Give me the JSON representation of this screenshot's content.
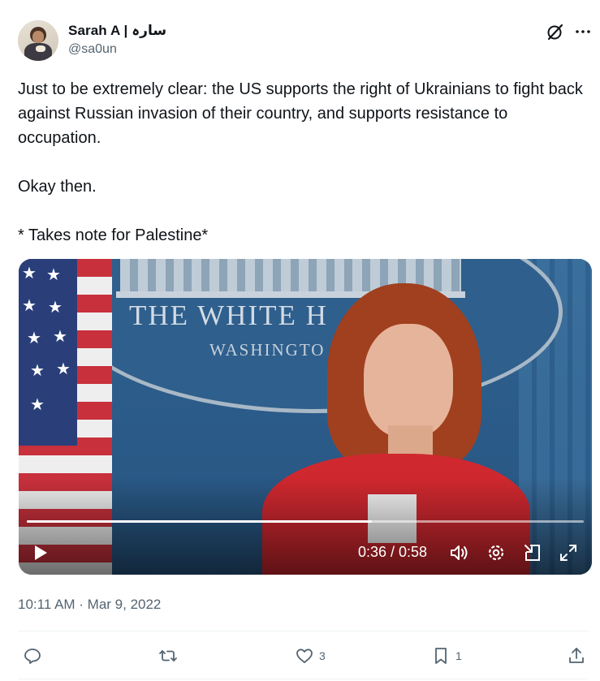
{
  "author": {
    "display_name": "Sarah A | سارہ",
    "handle": "@sa0un"
  },
  "tweet": {
    "text": "Just to be extremely clear: the US supports the right of Ukrainians to fight back against Russian invasion of their country, and supports resistance to occupation.\n\nOkay then.\n\n* Takes note for Palestine*",
    "timestamp": "10:11 AM · Mar 9, 2022"
  },
  "video": {
    "sign_title": "THE WHITE H",
    "sign_subtitle": "WASHINGTO",
    "current_time": "0:36",
    "duration": "0:58",
    "time_display": "0:36 / 0:58",
    "progress": 0.62
  },
  "actions": {
    "reply_count": "",
    "retweet_count": "",
    "like_count": "3",
    "bookmark_count": "1"
  },
  "icons": {
    "header": [
      "grok-icon",
      "more-icon"
    ],
    "video_controls": [
      "play-icon",
      "volume-icon",
      "settings-icon",
      "picture-in-picture-icon",
      "fullscreen-icon"
    ],
    "actions": [
      "reply-icon",
      "retweet-icon",
      "like-icon",
      "bookmark-icon",
      "share-icon"
    ]
  },
  "colors": {
    "text": "#0f1419",
    "secondary": "#536471",
    "divider": "#eff3f4"
  }
}
